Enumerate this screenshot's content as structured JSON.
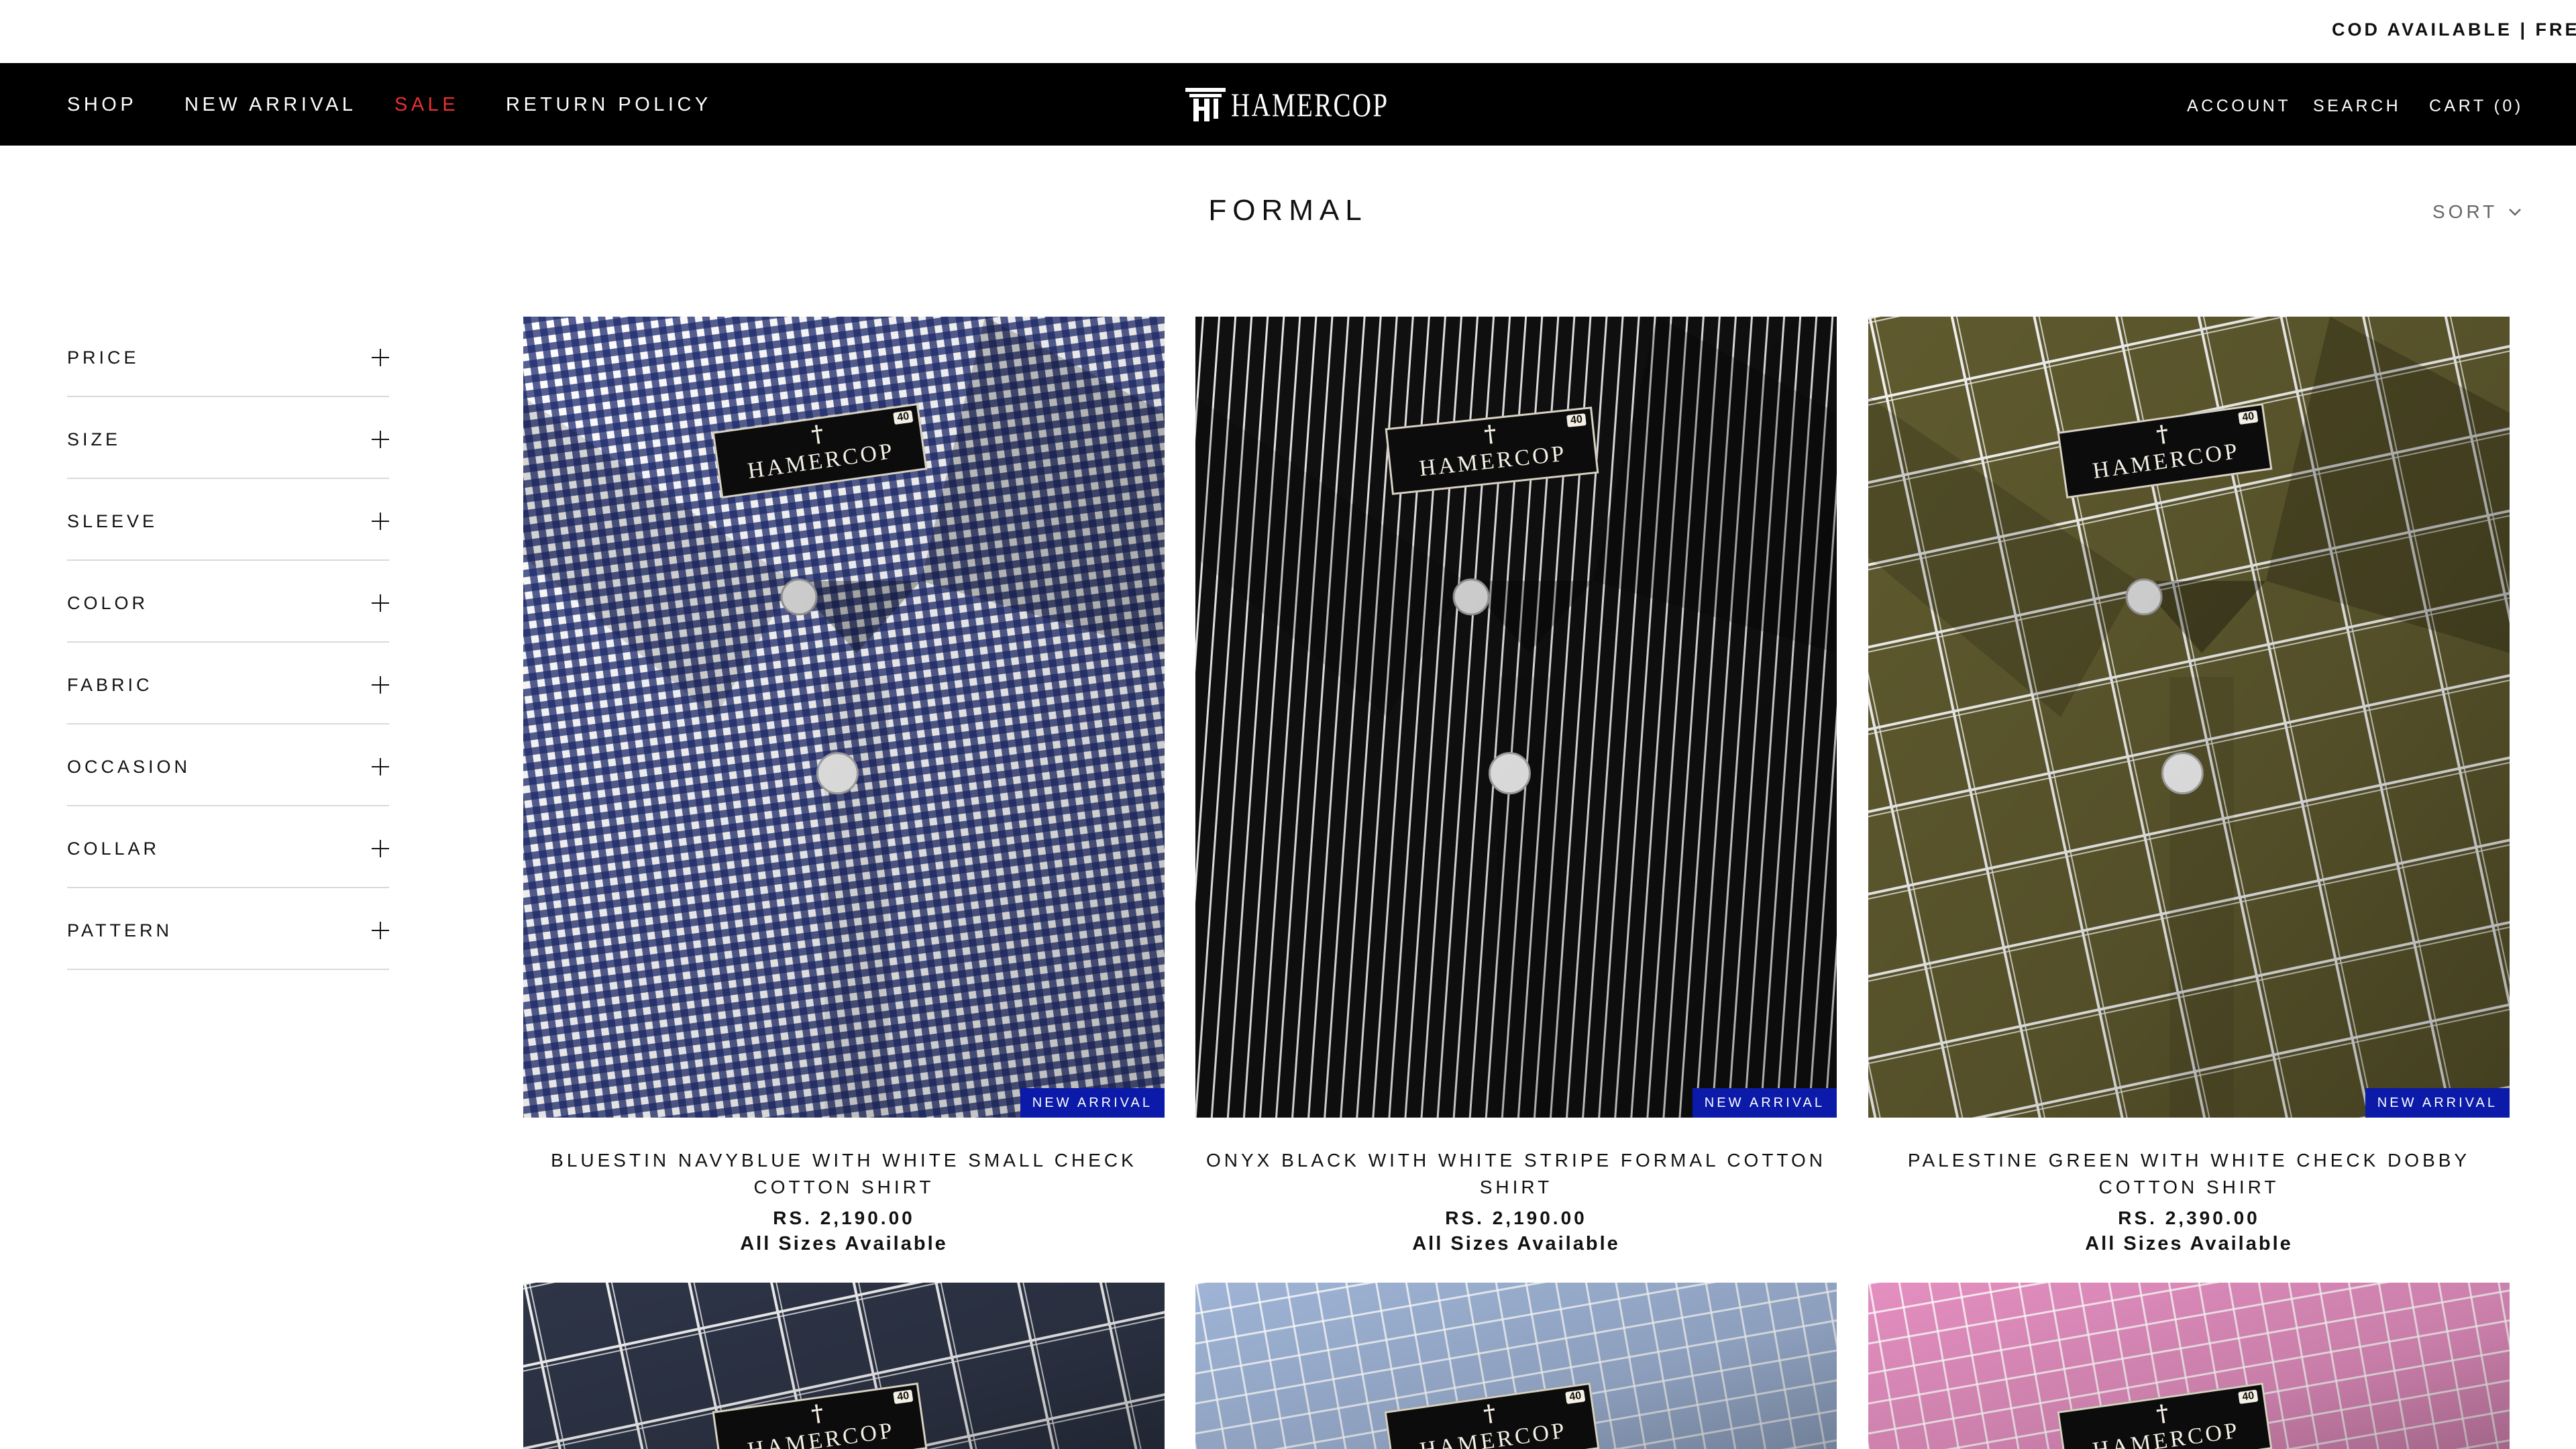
{
  "announcement": "COD AVAILABLE | FRE",
  "nav": {
    "items": [
      "SHOP",
      "NEW ARRIVAL",
      "SALE",
      "RETURN POLICY"
    ],
    "logo_text": "HAMERCOP",
    "account": "ACCOUNT",
    "search": "SEARCH",
    "cart": "CART (0)"
  },
  "page": {
    "title": "FORMAL",
    "sort_label": "SORT"
  },
  "filters": [
    "PRICE",
    "SIZE",
    "SLEEVE",
    "COLOR",
    "FABRIC",
    "OCCASION",
    "COLLAR",
    "PATTERN"
  ],
  "products": [
    {
      "title": "BLUESTIN NAVYBLUE WITH WHITE SMALL CHECK COTTON SHIRT",
      "price": "RS. 2,190.00",
      "availability": "All Sizes Available",
      "badge": "NEW ARRIVAL",
      "label_text": "HAMERCOP",
      "label_size": "40",
      "color": "#1d2a6e",
      "pattern": "small-check"
    },
    {
      "title": "ONYX BLACK WITH WHITE STRIPE FORMAL COTTON SHIRT",
      "price": "RS. 2,190.00",
      "availability": "All Sizes Available",
      "badge": "NEW ARRIVAL",
      "label_text": "HAMERCOP",
      "label_size": "40",
      "color": "#101010",
      "pattern": "stripe"
    },
    {
      "title": "PALESTINE GREEN WITH WHITE CHECK DOBBY COTTON SHIRT",
      "price": "RS. 2,390.00",
      "availability": "All Sizes Available",
      "badge": "NEW ARRIVAL",
      "label_text": "HAMERCOP",
      "label_size": "40",
      "color": "#5f5a2e",
      "pattern": "window-check"
    },
    {
      "label_text": "HAMERCOP",
      "label_size": "40",
      "color": "#2e3547",
      "pattern": "window-check"
    },
    {
      "label_text": "HAMERCOP",
      "label_size": "40",
      "color": "#9fb4d6",
      "pattern": "check"
    },
    {
      "label_text": "HAMERCOP",
      "label_size": "40",
      "color": "#e48fc0",
      "pattern": "check"
    }
  ],
  "colors": {
    "header_bg": "#000000",
    "sale": "#e8302f",
    "badge_bg": "#0b1aa8"
  }
}
